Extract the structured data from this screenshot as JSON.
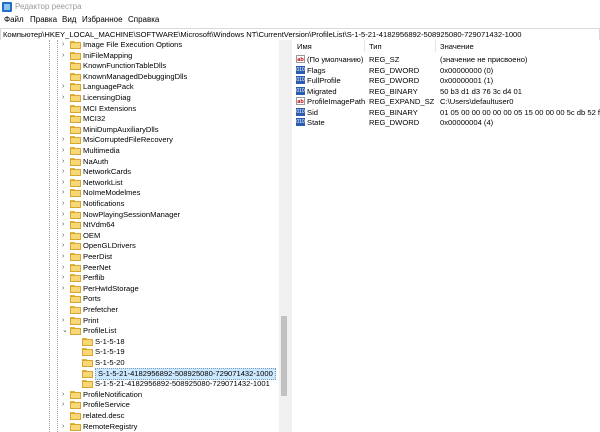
{
  "window": {
    "title": "Редактор реестра"
  },
  "menu": [
    "Файл",
    "Правка",
    "Вид",
    "Избранное",
    "Справка"
  ],
  "address": "Компьютер\\HKEY_LOCAL_MACHINE\\SOFTWARE\\Microsoft\\Windows NT\\CurrentVersion\\ProfileList\\S-1-5-21-4182956892-508925080-729071432-1000",
  "tree": [
    {
      "label": "Image File Execution Options",
      "level": 0,
      "expandable": true,
      "selected": false
    },
    {
      "label": "IniFileMapping",
      "level": 0,
      "expandable": true,
      "selected": false
    },
    {
      "label": "KnownFunctionTableDlls",
      "level": 0,
      "expandable": false,
      "selected": false
    },
    {
      "label": "KnownManagedDebuggingDlls",
      "level": 0,
      "expandable": false,
      "selected": false
    },
    {
      "label": "LanguagePack",
      "level": 0,
      "expandable": true,
      "selected": false
    },
    {
      "label": "LicensingDiag",
      "level": 0,
      "expandable": true,
      "selected": false
    },
    {
      "label": "MCI Extensions",
      "level": 0,
      "expandable": false,
      "selected": false
    },
    {
      "label": "MCI32",
      "level": 0,
      "expandable": false,
      "selected": false
    },
    {
      "label": "MiniDumpAuxiliaryDlls",
      "level": 0,
      "expandable": false,
      "selected": false
    },
    {
      "label": "MsiCorruptedFileRecovery",
      "level": 0,
      "expandable": true,
      "selected": false
    },
    {
      "label": "Multimedia",
      "level": 0,
      "expandable": true,
      "selected": false
    },
    {
      "label": "NaAuth",
      "level": 0,
      "expandable": true,
      "selected": false
    },
    {
      "label": "NetworkCards",
      "level": 0,
      "expandable": true,
      "selected": false
    },
    {
      "label": "NetworkList",
      "level": 0,
      "expandable": true,
      "selected": false
    },
    {
      "label": "NoImeModelmes",
      "level": 0,
      "expandable": true,
      "selected": false
    },
    {
      "label": "Notifications",
      "level": 0,
      "expandable": true,
      "selected": false
    },
    {
      "label": "NowPlayingSessionManager",
      "level": 0,
      "expandable": true,
      "selected": false
    },
    {
      "label": "NtVdm64",
      "level": 0,
      "expandable": true,
      "selected": false
    },
    {
      "label": "OEM",
      "level": 0,
      "expandable": true,
      "selected": false
    },
    {
      "label": "OpenGLDrivers",
      "level": 0,
      "expandable": true,
      "selected": false
    },
    {
      "label": "PeerDist",
      "level": 0,
      "expandable": true,
      "selected": false
    },
    {
      "label": "PeerNet",
      "level": 0,
      "expandable": true,
      "selected": false
    },
    {
      "label": "Perflib",
      "level": 0,
      "expandable": true,
      "selected": false
    },
    {
      "label": "PerHwIdStorage",
      "level": 0,
      "expandable": true,
      "selected": false
    },
    {
      "label": "Ports",
      "level": 0,
      "expandable": false,
      "selected": false
    },
    {
      "label": "Prefetcher",
      "level": 0,
      "expandable": false,
      "selected": false
    },
    {
      "label": "Print",
      "level": 0,
      "expandable": true,
      "selected": false
    },
    {
      "label": "ProfileList",
      "level": 0,
      "expandable": true,
      "expanded": true,
      "selected": false
    },
    {
      "label": "S-1-5-18",
      "level": 1,
      "expandable": false,
      "selected": false
    },
    {
      "label": "S-1-5-19",
      "level": 1,
      "expandable": false,
      "selected": false
    },
    {
      "label": "S-1-5-20",
      "level": 1,
      "expandable": false,
      "selected": false
    },
    {
      "label": "S-1-5-21-4182956892-508925080-729071432-1000",
      "level": 1,
      "expandable": false,
      "selected": true
    },
    {
      "label": "S-1-5-21-4182956892-508925080-729071432-1001",
      "level": 1,
      "expandable": false,
      "selected": false
    },
    {
      "label": "ProfileNotification",
      "level": 0,
      "expandable": true,
      "selected": false
    },
    {
      "label": "ProfileService",
      "level": 0,
      "expandable": true,
      "selected": false
    },
    {
      "label": "related.desc",
      "level": 0,
      "expandable": false,
      "selected": false
    },
    {
      "label": "RemoteRegistry",
      "level": 0,
      "expandable": true,
      "selected": false
    }
  ],
  "columns": {
    "name": "Имя",
    "type": "Тип",
    "value": "Значение"
  },
  "values": [
    {
      "icon": "string-value-icon",
      "name": "(По умолчанию)",
      "type": "REG_SZ",
      "data": "(значение не присвоено)"
    },
    {
      "icon": "binary-value-icon",
      "name": "Flags",
      "type": "REG_DWORD",
      "data": "0x00000000 (0)"
    },
    {
      "icon": "binary-value-icon",
      "name": "FullProfile",
      "type": "REG_DWORD",
      "data": "0x00000001 (1)"
    },
    {
      "icon": "binary-value-icon",
      "name": "Migrated",
      "type": "REG_BINARY",
      "data": "50 b3 d1 d3 76 3c d4 01"
    },
    {
      "icon": "string-value-icon",
      "name": "ProfileImagePath",
      "type": "REG_EXPAND_SZ",
      "data": "C:\\Users\\defaultuser0"
    },
    {
      "icon": "binary-value-icon",
      "name": "Sid",
      "type": "REG_BINARY",
      "data": "01 05 00 00 00 00 00 05 15 00 00 00 5c db 52 f9 98 94"
    },
    {
      "icon": "binary-value-icon",
      "name": "State",
      "type": "REG_DWORD",
      "data": "0x00000004 (4)"
    }
  ]
}
